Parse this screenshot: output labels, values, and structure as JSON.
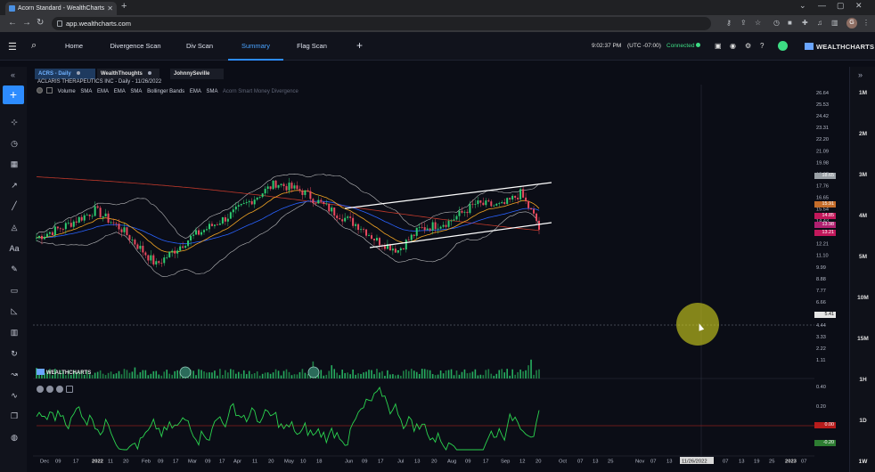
{
  "browser": {
    "tab_title": "Acorn Standard - WealthCharts",
    "url": "app.wealthcharts.com"
  },
  "header": {
    "tabs": [
      "Home",
      "Divergence Scan",
      "Div Scan",
      "Summary",
      "Flag Scan"
    ],
    "active_tab": "Summary",
    "time": "9:02:37 PM",
    "timezone": "(UTC -07:00)",
    "status": "Connected",
    "logo": "WEALTHCHARTS"
  },
  "chart_tabs": [
    {
      "label": "ACRS - Daily",
      "active": true
    },
    {
      "label": "WealthThoughts",
      "active": false
    },
    {
      "label": "JohnnySeville",
      "active": false
    }
  ],
  "ticker_line": "ACLARIS THERAPEUTICS INC  - Daily - 11/26/2022",
  "indicators": [
    "Volume",
    "SMA",
    "EMA",
    "EMA",
    "SMA",
    "Bollinger Bands",
    "EMA",
    "SMA"
  ],
  "indicator_muted": "Acorn Smart Money Divergence",
  "watermark": "WEALTHCHARTS",
  "price_axis": [
    "26.64",
    "25.53",
    "24.42",
    "23.31",
    "22.20",
    "21.09",
    "19.98",
    "18.87",
    "17.76",
    "16.65",
    "15.54",
    "14.43",
    "13.32",
    "12.21",
    "11.10",
    "9.99",
    "8.88",
    "7.77",
    "6.66",
    "5.55",
    "4.44",
    "3.33",
    "2.22",
    "1.11"
  ],
  "osc_axis": [
    "0.40",
    "0.20",
    "-0.20"
  ],
  "price_tags": [
    {
      "value": "18.65",
      "color": "#9aa0a6"
    },
    {
      "value": "15.91",
      "color": "#c56d2a"
    },
    {
      "value": "14.85",
      "color": "#c2185b"
    },
    {
      "value": "13.98",
      "color": "#b02070"
    },
    {
      "value": "13.21",
      "color": "#c2185b"
    },
    {
      "value": "5.41",
      "color": "#e6e6e6"
    },
    {
      "value": "0.00",
      "color": "#b71c1c"
    },
    {
      "value": "-0.20",
      "color": "#2e7d32"
    }
  ],
  "intervals": [
    "1M",
    "2M",
    "3M",
    "4M",
    "5M",
    "10M",
    "15M",
    "1H",
    "1D",
    "1W"
  ],
  "time_axis": [
    "Dec",
    "09",
    "17",
    "2022",
    "11",
    "20",
    "Feb",
    "09",
    "17",
    "Mar",
    "09",
    "17",
    "Apr",
    "11",
    "20",
    "May",
    "10",
    "18",
    "Jun",
    "09",
    "17",
    "Jul",
    "13",
    "20",
    "Aug",
    "09",
    "17",
    "Sep",
    "12",
    "20",
    "Oct",
    "07",
    "13",
    "25",
    "Nov",
    "07",
    "13",
    "11/26/2022",
    "07",
    "13",
    "19",
    "25",
    "2023",
    "07"
  ],
  "time_axis_bold": [
    "2022",
    "2023"
  ],
  "colors": {
    "accent": "#2d8cff",
    "up": "#2ecc71",
    "down": "#e84a5f",
    "sma_red": "#c0392b",
    "ema_blue": "#2962ff",
    "ema_orange": "#f5a623",
    "bollinger": "#e6e6e6",
    "osc_line": "#2bd44f",
    "highlight": "#d6d61e"
  },
  "toolbar_icons": [
    "crosshair-icon",
    "clock-icon",
    "calendar-icon",
    "trend-icon",
    "line-icon",
    "fill-icon",
    "text-icon",
    "brush-icon",
    "ruler-icon",
    "measure-icon",
    "trash-icon",
    "sync-icon",
    "chart-icon",
    "indicator-icon",
    "copy-icon",
    "globe-icon"
  ]
}
